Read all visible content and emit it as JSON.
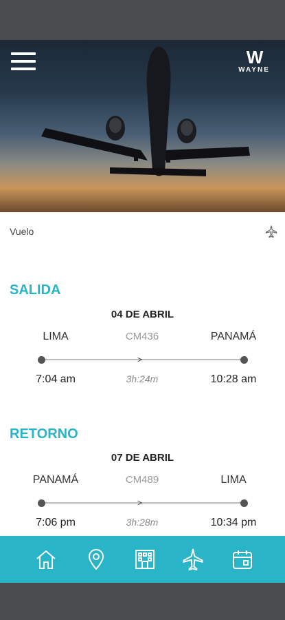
{
  "header": {
    "logo_text": "WAYNE",
    "logo_mark": "W"
  },
  "flight_panel": {
    "label": "Vuelo"
  },
  "departure": {
    "title": "SALIDA",
    "date": "04 DE ABRIL",
    "origin": "LIMA",
    "flight_code": "CM436",
    "destination": "PANAMÁ",
    "depart_time": "7:04 am",
    "duration": "3h:24m",
    "arrive_time": "10:28 am"
  },
  "return": {
    "title": "RETORNO",
    "date": "07 DE ABRIL",
    "origin": "PANAMÁ",
    "flight_code": "CM489",
    "destination": "LIMA",
    "depart_time": "7:06 pm",
    "duration": "3h:28m",
    "arrive_time": "10:34 pm"
  },
  "navbar": {
    "items": [
      "home-icon",
      "location-pin-icon",
      "hotel-icon",
      "airplane-icon",
      "calendar-icon"
    ],
    "active": "airplane-icon",
    "color": "#29b4c8"
  },
  "colors": {
    "accent": "#29b4c8",
    "frame": "#4a4b4d"
  }
}
